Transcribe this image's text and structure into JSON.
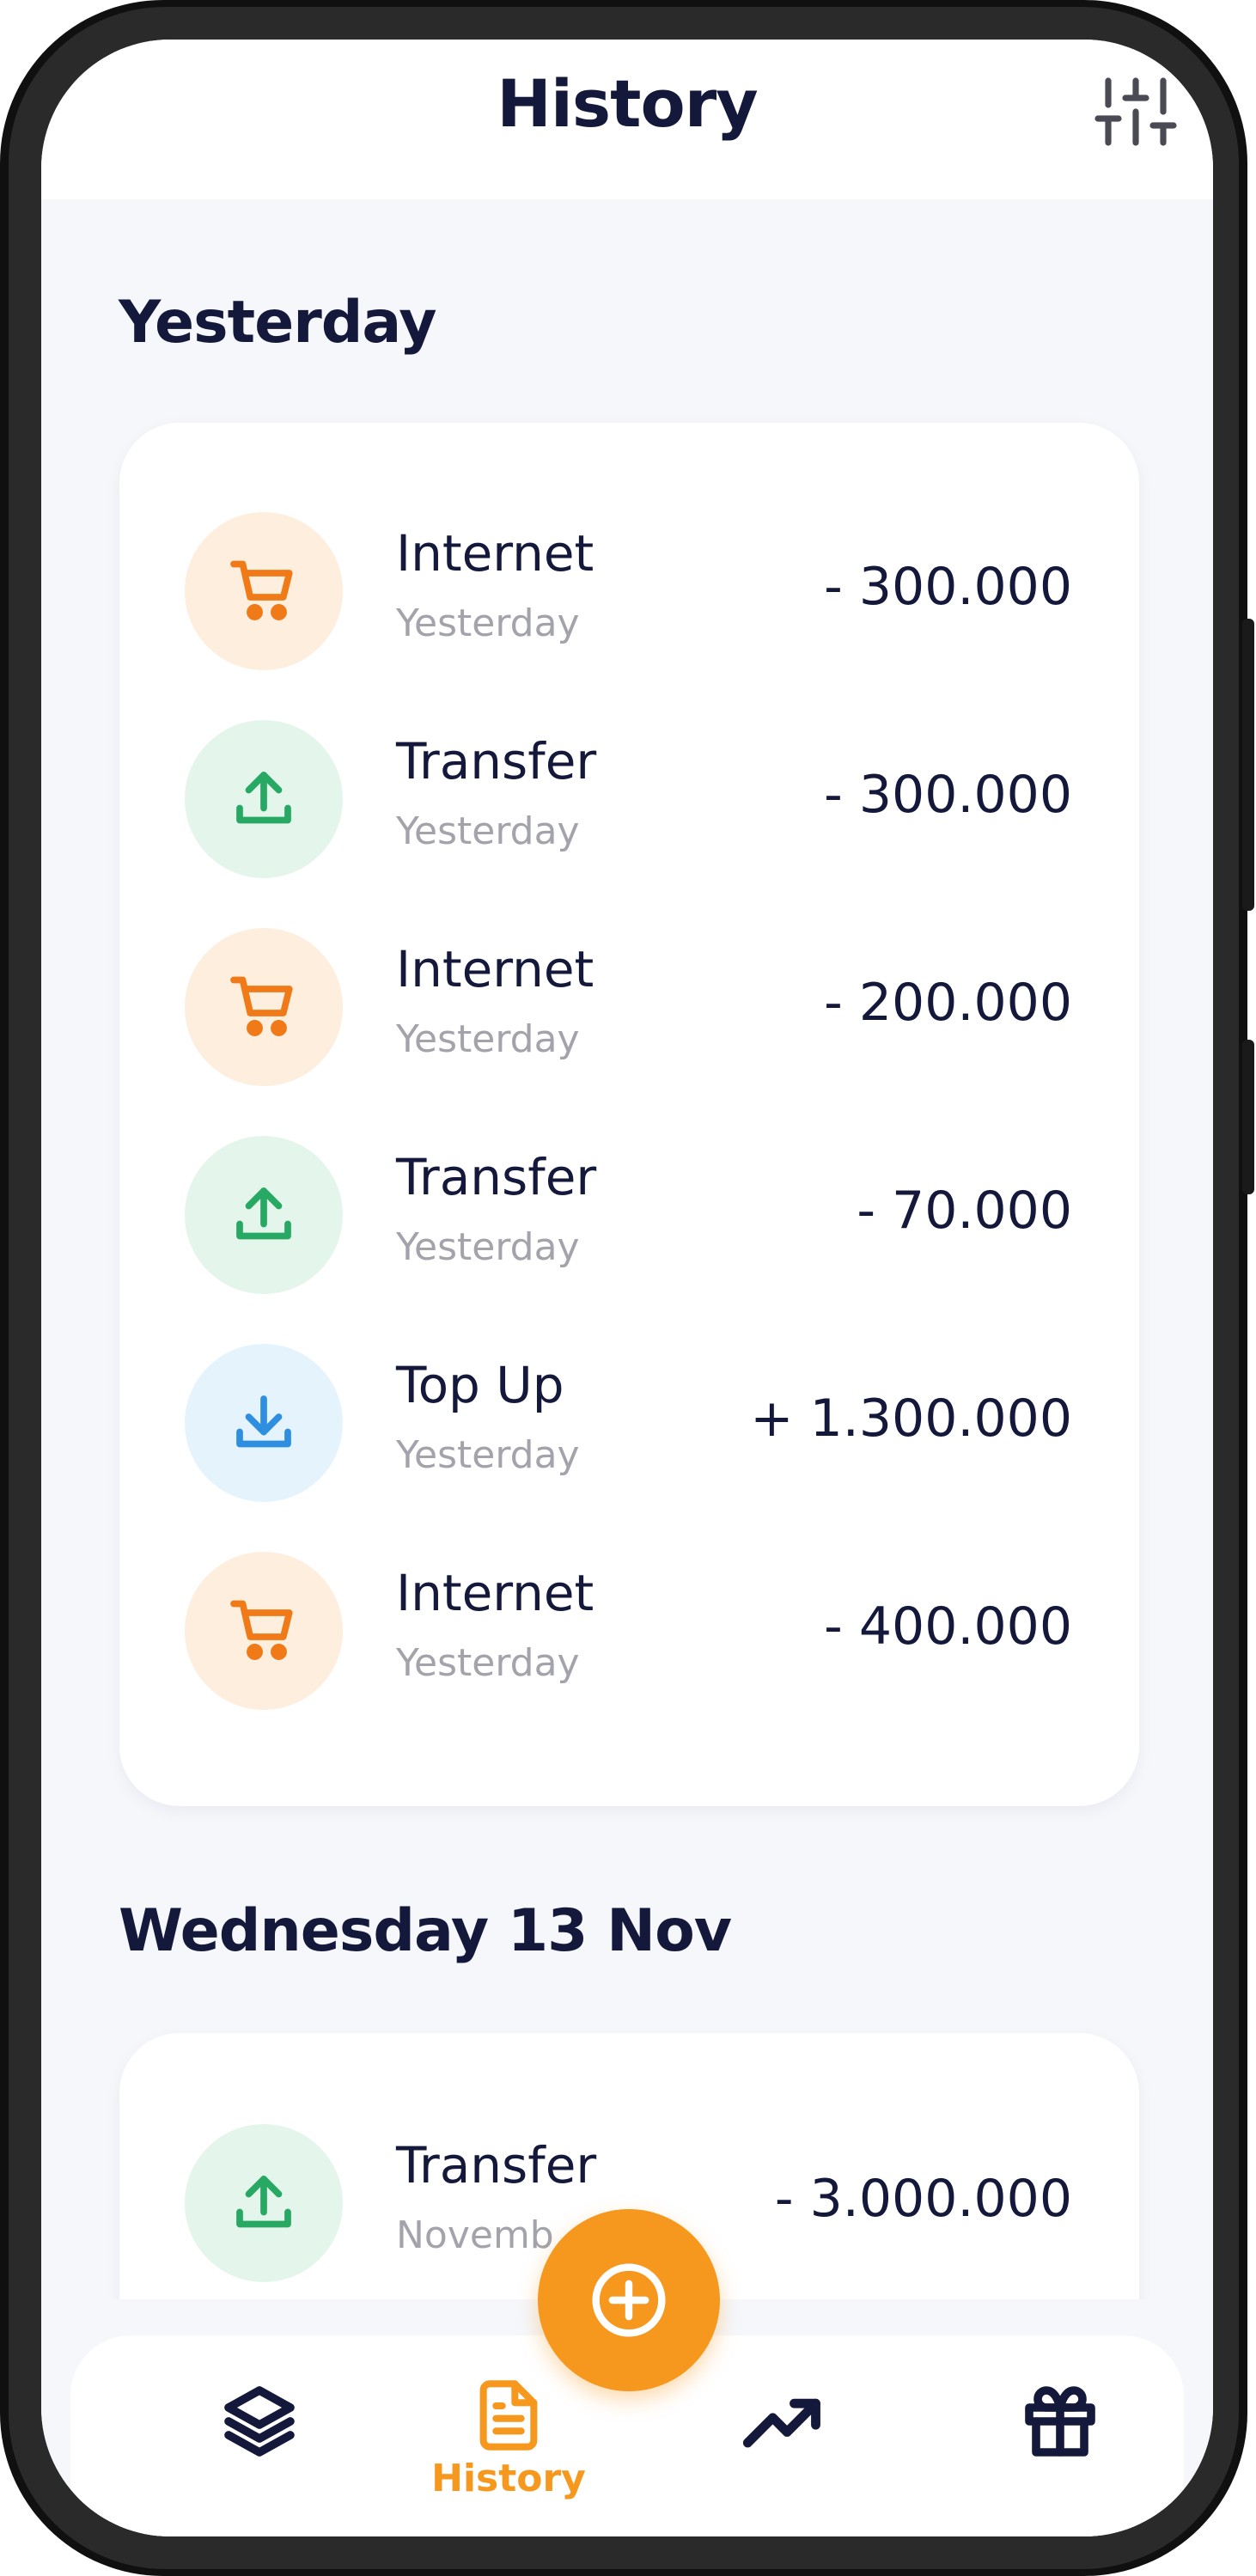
{
  "header": {
    "title": "History"
  },
  "sections": [
    {
      "title": "Yesterday",
      "transactions": [
        {
          "title": "Internet",
          "subtitle": "Yesterday",
          "amount": "- 300.000",
          "icon": "cart-icon"
        },
        {
          "title": "Transfer",
          "subtitle": "Yesterday",
          "amount": "- 300.000",
          "icon": "upload-icon"
        },
        {
          "title": "Internet",
          "subtitle": "Yesterday",
          "amount": "- 200.000",
          "icon": "cart-icon"
        },
        {
          "title": "Transfer",
          "subtitle": "Yesterday",
          "amount": "- 70.000",
          "icon": "upload-icon"
        },
        {
          "title": "Top Up",
          "subtitle": "Yesterday",
          "amount": "+ 1.300.000",
          "icon": "download-icon"
        },
        {
          "title": "Internet",
          "subtitle": "Yesterday",
          "amount": "- 400.000",
          "icon": "cart-icon"
        }
      ]
    },
    {
      "title": "Wednesday 13 Nov",
      "transactions": [
        {
          "title": "Transfer",
          "subtitle": "Novemb",
          "amount": "- 3.000.000",
          "icon": "upload-icon"
        }
      ]
    }
  ],
  "nav": {
    "items": [
      {
        "icon": "layers-icon"
      },
      {
        "icon": "document-icon",
        "label": "History",
        "active": true
      },
      {
        "icon": "trending-up-icon"
      },
      {
        "icon": "gift-icon"
      }
    ],
    "fab_icon": "plus-circle-icon"
  },
  "colors": {
    "accent": "#F7981E",
    "text_dark": "#14193B",
    "muted": "#A3A3AB",
    "cart": "#F07A17",
    "upload": "#27A863",
    "download": "#2E8FE0",
    "background": "#F5F7FB"
  }
}
